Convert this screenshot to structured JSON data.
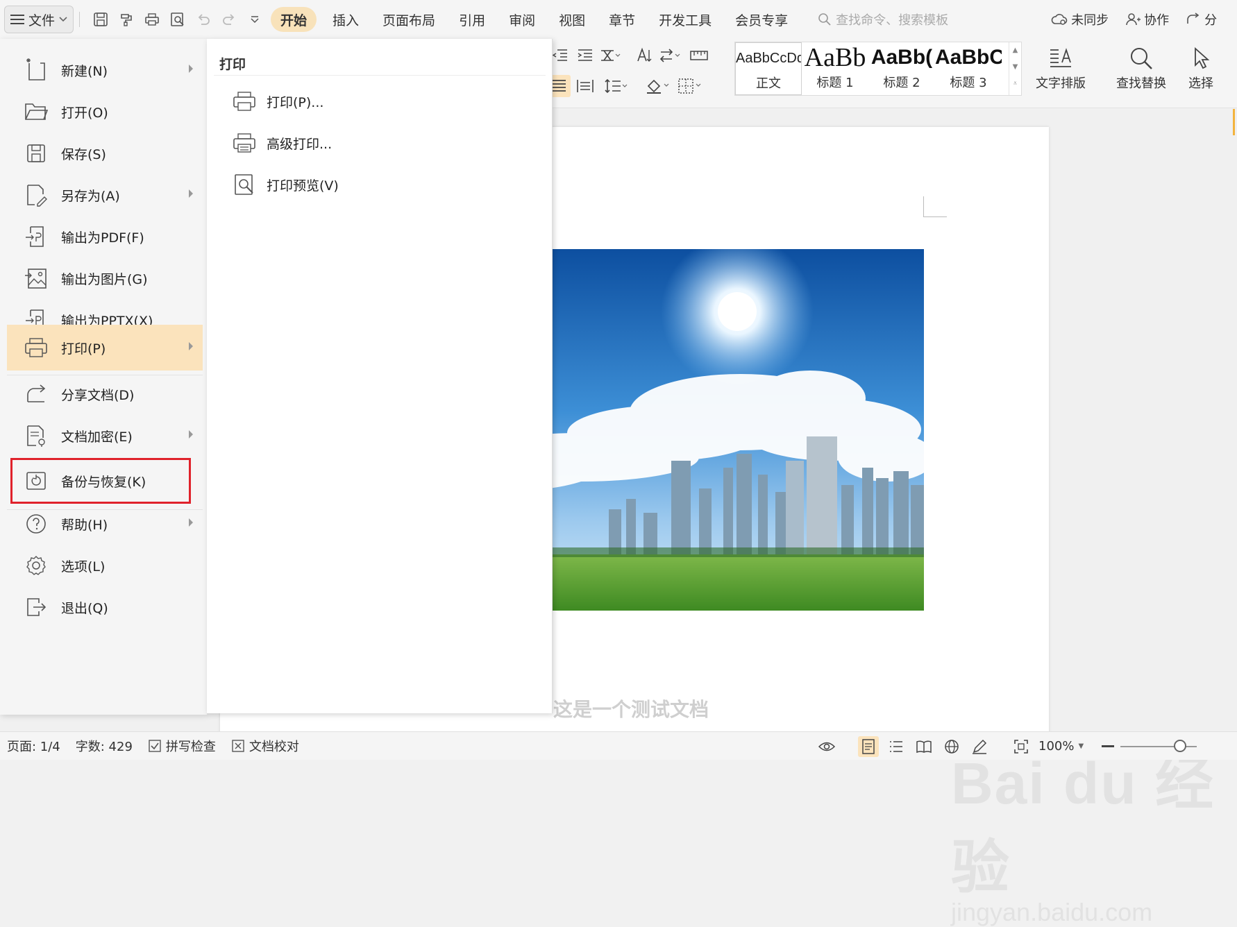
{
  "menubar": {
    "file_label": "文件",
    "tabs": [
      {
        "label": "开始",
        "active": true
      },
      {
        "label": "插入"
      },
      {
        "label": "页面布局"
      },
      {
        "label": "引用"
      },
      {
        "label": "审阅"
      },
      {
        "label": "视图"
      },
      {
        "label": "章节"
      },
      {
        "label": "开发工具"
      },
      {
        "label": "会员专享"
      }
    ],
    "search_placeholder": "查找命令、搜索模板",
    "sync_label": "未同步",
    "collab_label": "协作",
    "share_label": "分"
  },
  "ribbon": {
    "styles": [
      {
        "sample": "AaBbCcDd",
        "name": "正文"
      },
      {
        "sample": "AaBb",
        "name": "标题 1"
      },
      {
        "sample": "AaBb(",
        "name": "标题 2"
      },
      {
        "sample": "AaBbC",
        "name": "标题 3"
      }
    ],
    "text_layout": "文字排版",
    "find_replace": "查找替换",
    "select": "选择"
  },
  "file_menu": {
    "items": [
      {
        "label": "新建(N)",
        "icon": "new-doc-icon",
        "submenu": true
      },
      {
        "label": "打开(O)",
        "icon": "folder-open-icon"
      },
      {
        "label": "保存(S)",
        "icon": "save-icon"
      },
      {
        "label": "另存为(A)",
        "icon": "save-as-icon",
        "submenu": true
      },
      {
        "label": "输出为PDF(F)",
        "icon": "export-pdf-icon"
      },
      {
        "label": "输出为图片(G)",
        "icon": "export-image-icon"
      },
      {
        "label": "输出为PPTX(X)",
        "icon": "export-pptx-icon"
      },
      {
        "label": "打印(P)",
        "icon": "print-icon",
        "submenu": true,
        "active": true
      },
      {
        "label": "分享文档(D)",
        "icon": "share-icon"
      },
      {
        "label": "文档加密(E)",
        "icon": "encrypt-icon",
        "submenu": true
      },
      {
        "label": "备份与恢复(K)",
        "icon": "backup-restore-icon",
        "submenu": true,
        "highlighted": true
      },
      {
        "label": "帮助(H)",
        "icon": "help-icon",
        "submenu": true
      },
      {
        "label": "选项(L)",
        "icon": "settings-icon"
      },
      {
        "label": "退出(Q)",
        "icon": "exit-icon"
      }
    ]
  },
  "print_panel": {
    "title": "打印",
    "items": [
      {
        "label": "打印(P)...",
        "icon": "printer-icon"
      },
      {
        "label": "高级打印...",
        "icon": "advanced-print-icon"
      },
      {
        "label": "打印预览(V)",
        "icon": "print-preview-icon"
      }
    ]
  },
  "document": {
    "body_text": "这是一个测试文档",
    "watermark_brand": "Bai du 经验",
    "watermark_url": "jingyan.baidu.com"
  },
  "statusbar": {
    "page": "页面: 1/4",
    "word_count": "字数: 429",
    "spell_check": "拼写检查",
    "doc_proof": "文档校对",
    "zoom": "100%",
    "zoom_fraction": 0.78
  },
  "colors": {
    "accent": "#f8e2ba",
    "menu_active": "#fbe3bc",
    "highlight_box": "#e0222b"
  }
}
